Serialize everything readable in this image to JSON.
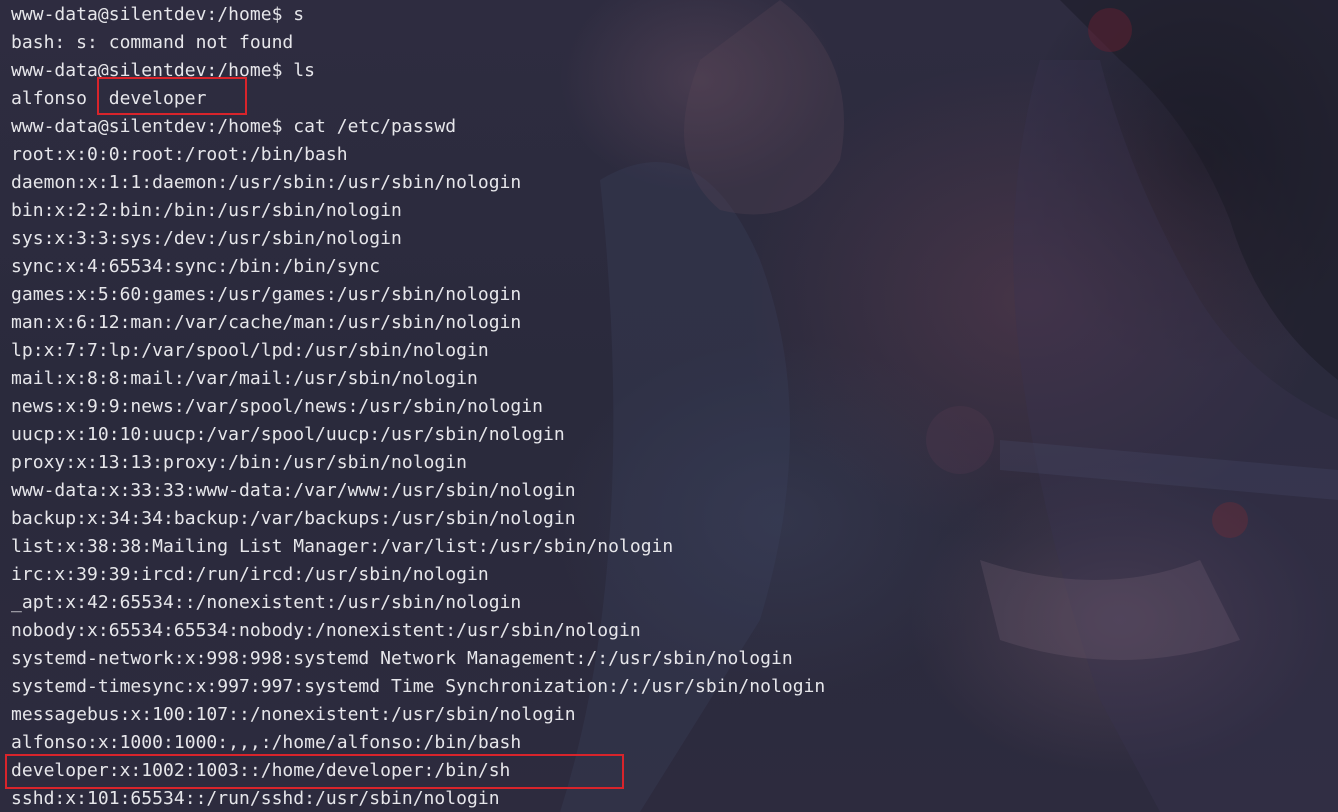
{
  "terminal": {
    "lines": [
      "www-data@silentdev:/home$ s",
      "bash: s: command not found",
      "www-data@silentdev:/home$ ls",
      "alfonso  developer",
      "www-data@silentdev:/home$ cat /etc/passwd",
      "root:x:0:0:root:/root:/bin/bash",
      "daemon:x:1:1:daemon:/usr/sbin:/usr/sbin/nologin",
      "bin:x:2:2:bin:/bin:/usr/sbin/nologin",
      "sys:x:3:3:sys:/dev:/usr/sbin/nologin",
      "sync:x:4:65534:sync:/bin:/bin/sync",
      "games:x:5:60:games:/usr/games:/usr/sbin/nologin",
      "man:x:6:12:man:/var/cache/man:/usr/sbin/nologin",
      "lp:x:7:7:lp:/var/spool/lpd:/usr/sbin/nologin",
      "mail:x:8:8:mail:/var/mail:/usr/sbin/nologin",
      "news:x:9:9:news:/var/spool/news:/usr/sbin/nologin",
      "uucp:x:10:10:uucp:/var/spool/uucp:/usr/sbin/nologin",
      "proxy:x:13:13:proxy:/bin:/usr/sbin/nologin",
      "www-data:x:33:33:www-data:/var/www:/usr/sbin/nologin",
      "backup:x:34:34:backup:/var/backups:/usr/sbin/nologin",
      "list:x:38:38:Mailing List Manager:/var/list:/usr/sbin/nologin",
      "irc:x:39:39:ircd:/run/ircd:/usr/sbin/nologin",
      "_apt:x:42:65534::/nonexistent:/usr/sbin/nologin",
      "nobody:x:65534:65534:nobody:/nonexistent:/usr/sbin/nologin",
      "systemd-network:x:998:998:systemd Network Management:/:/usr/sbin/nologin",
      "systemd-timesync:x:997:997:systemd Time Synchronization:/:/usr/sbin/nologin",
      "messagebus:x:100:107::/nonexistent:/usr/sbin/nologin",
      "alfonso:x:1000:1000:,,,:/home/alfonso:/bin/bash",
      "developer:x:1002:1003::/home/developer:/bin/sh",
      "sshd:x:101:65534::/run/sshd:/usr/sbin/nologin"
    ]
  },
  "colors": {
    "text": "#e6e6ea",
    "highlight_border": "#d8242b",
    "background": "#2b2a3d"
  }
}
